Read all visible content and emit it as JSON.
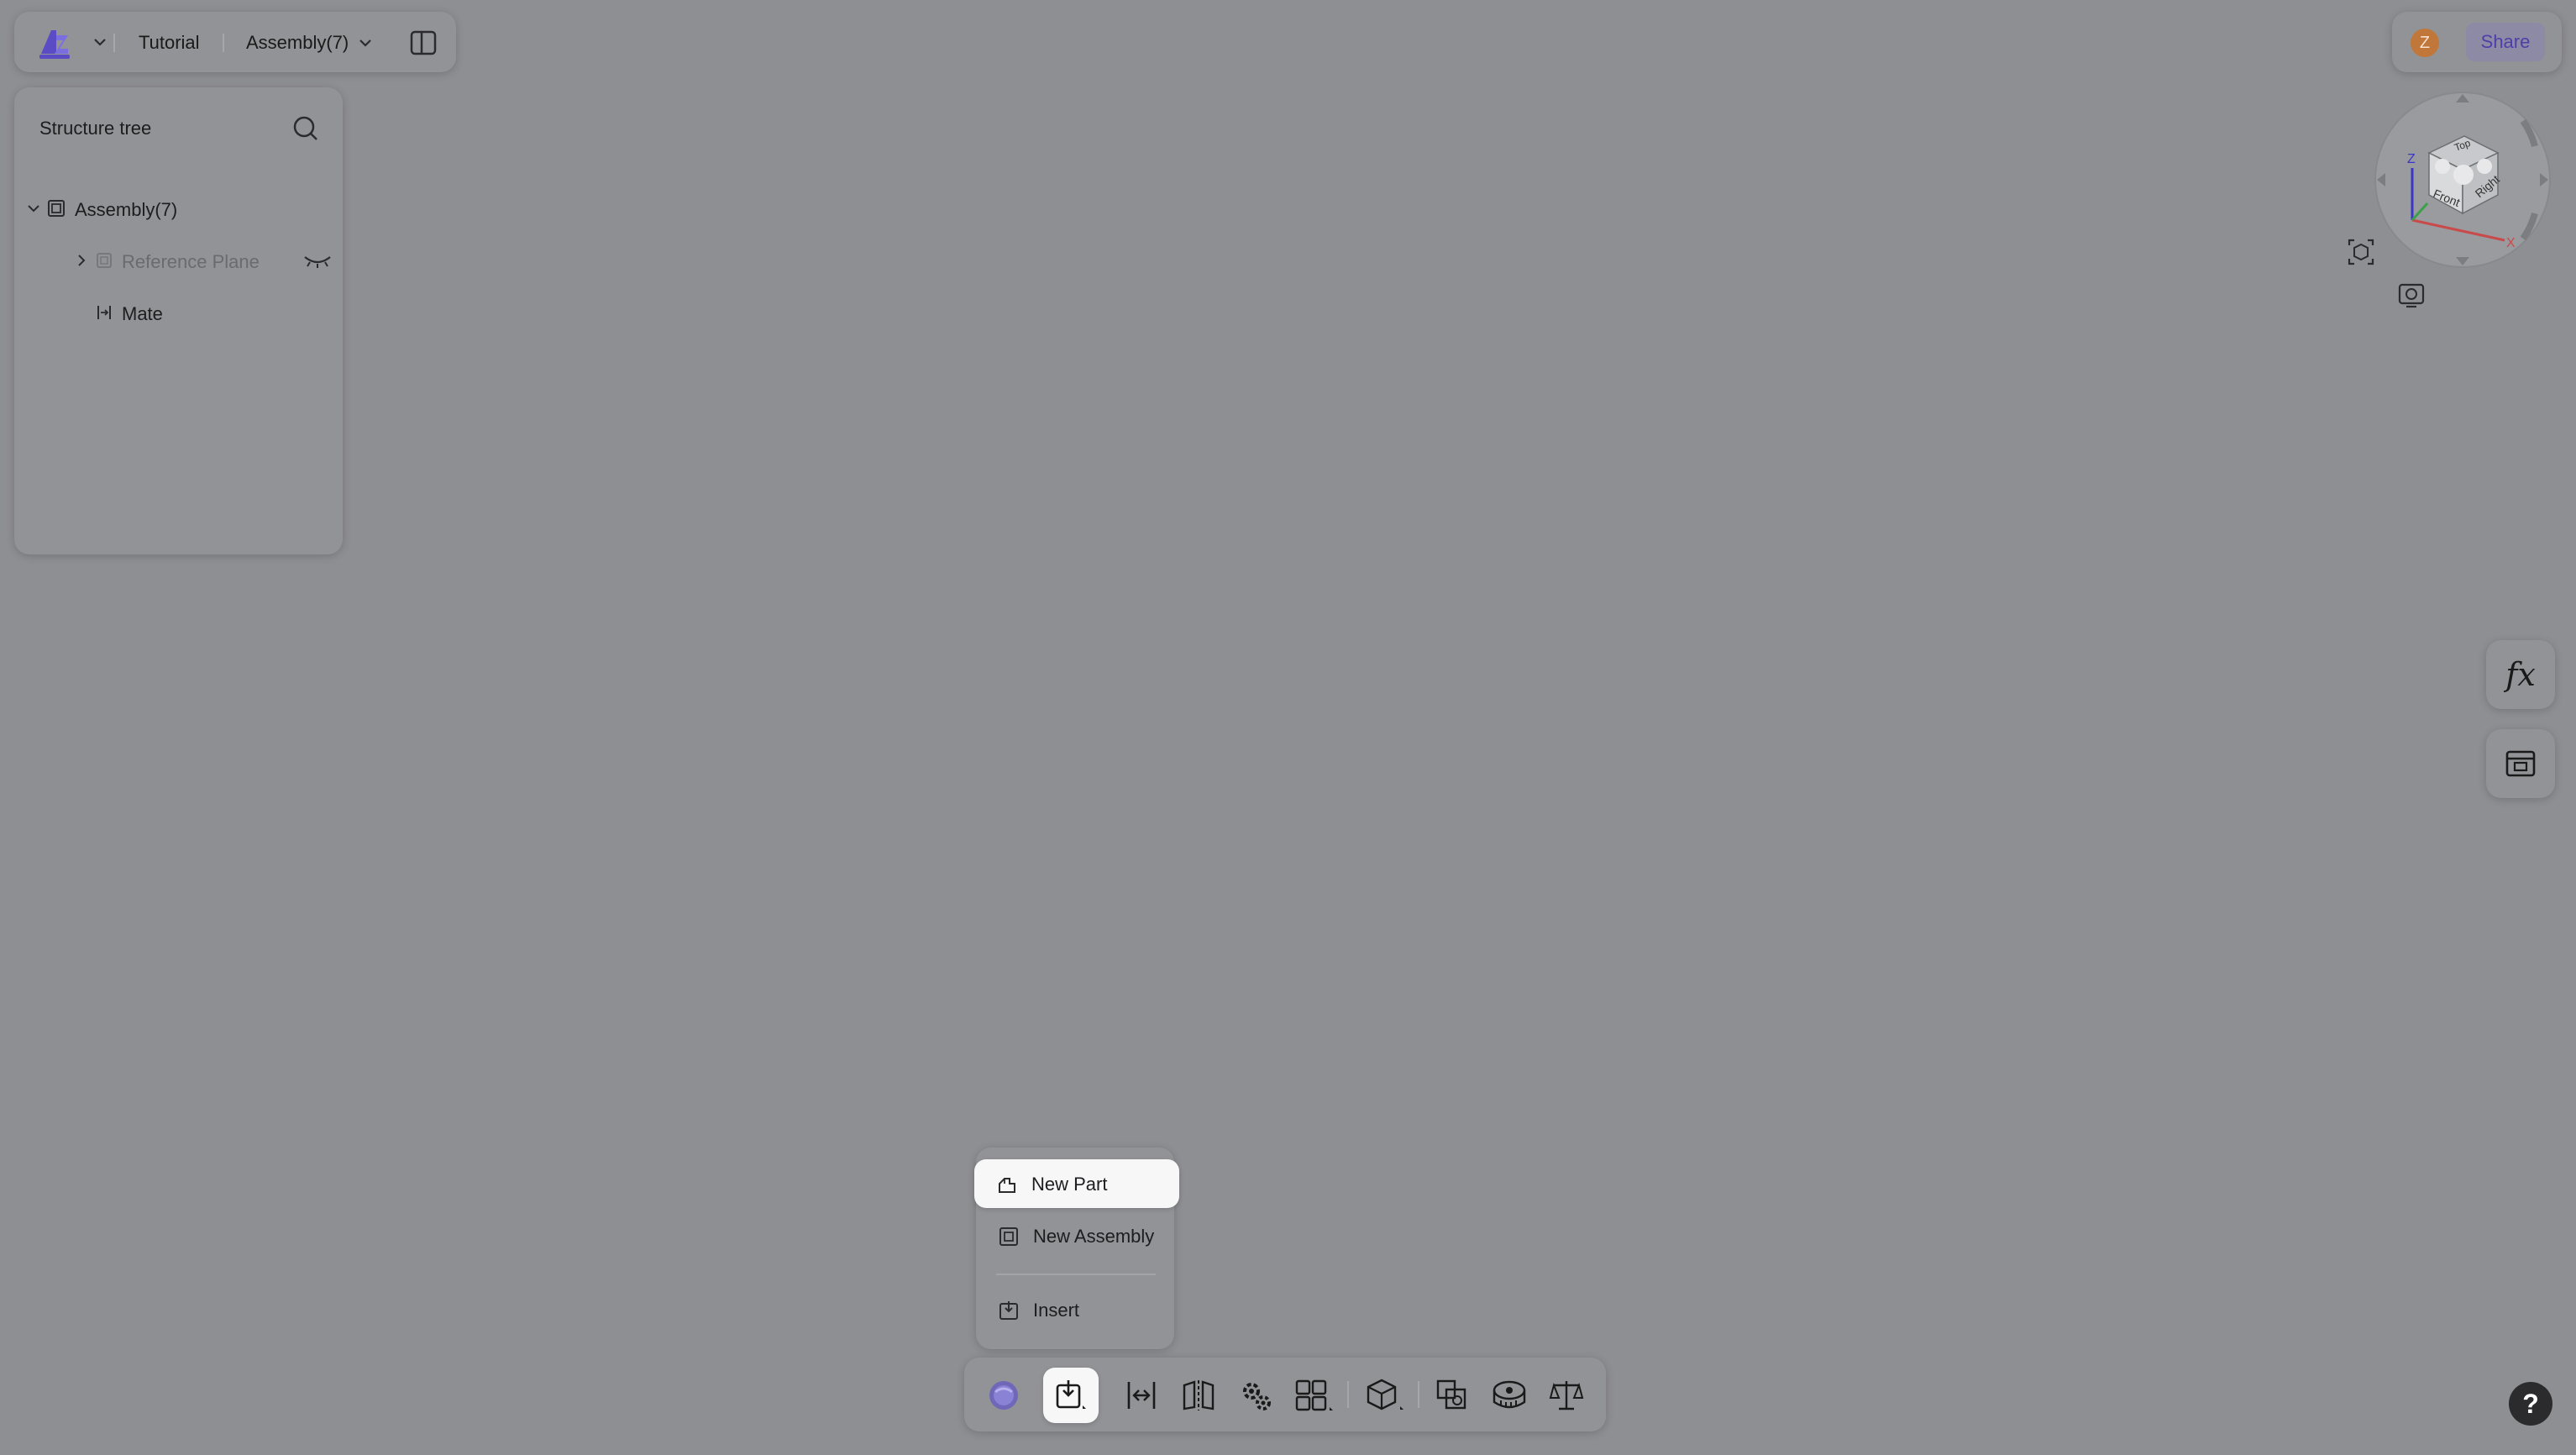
{
  "topbar": {
    "crumbs": [
      "Tutorial",
      "Assembly(7)"
    ]
  },
  "tree": {
    "title": "Structure tree",
    "items": [
      {
        "label": "Assembly(7)"
      },
      {
        "label": "Reference Plane"
      },
      {
        "label": "Mate"
      }
    ]
  },
  "share": {
    "avatar_initial": "Z",
    "label": "Share"
  },
  "viewcube": {
    "faces": [
      "Top",
      "Front",
      "Right"
    ],
    "axes": [
      "Z",
      "X"
    ]
  },
  "fx": {
    "label": "fx"
  },
  "menu": {
    "items": [
      "New Part",
      "New Assembly",
      "Insert"
    ]
  },
  "toolbar": {
    "icons": [
      "sketch-orb-icon",
      "insert-component-icon",
      "mate-icon",
      "mirror-icon",
      "gear-icon",
      "pattern-icon",
      "explode-view-icon",
      "interference-check-icon",
      "measure-icon",
      "mass-properties-icon"
    ]
  },
  "help": {
    "label": "?"
  },
  "colors": {
    "canvas": "#8e8f92",
    "panel": "#929396",
    "accent": "#4e3fa8",
    "avatar": "#c1773a"
  }
}
